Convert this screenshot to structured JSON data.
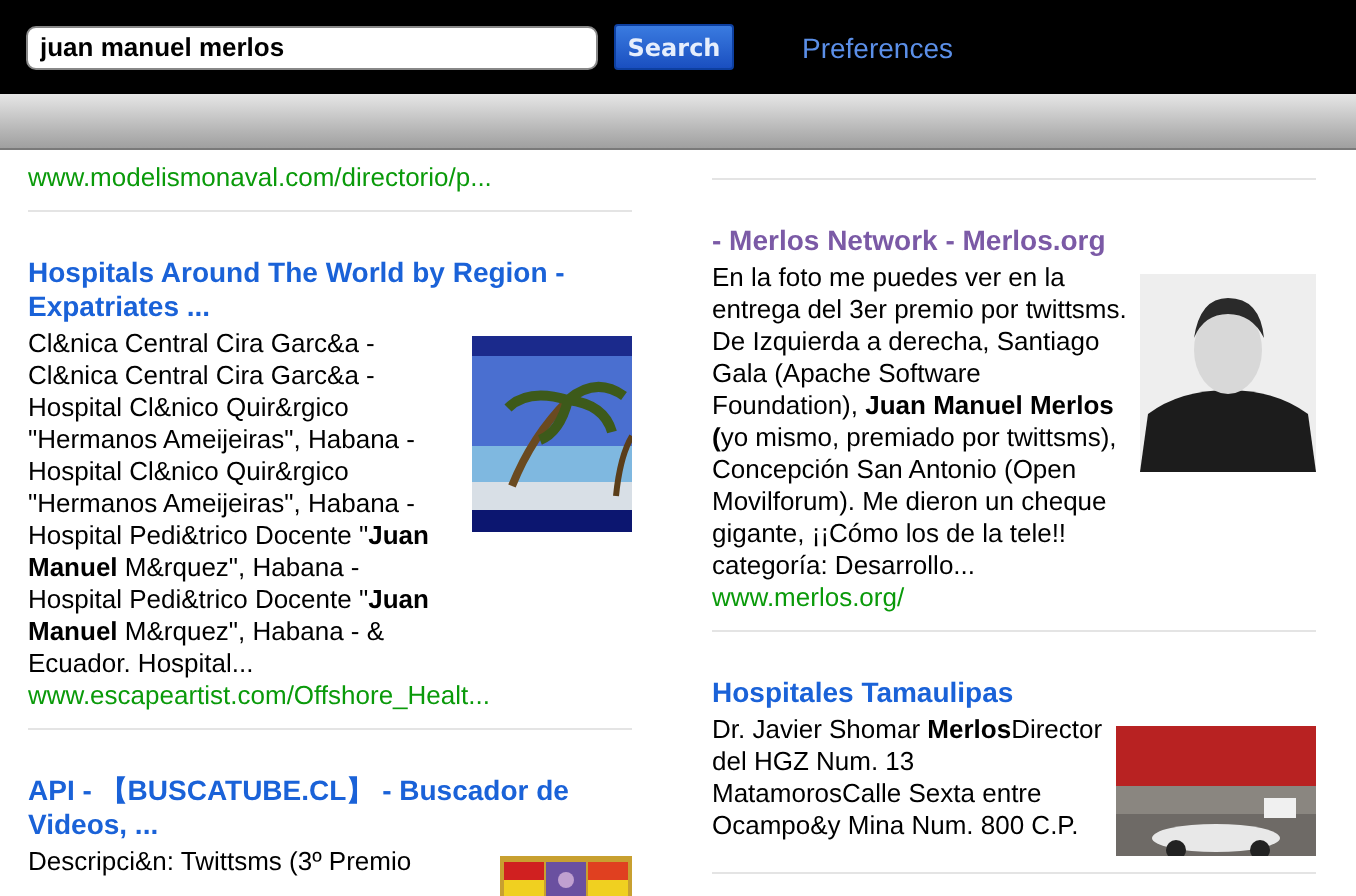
{
  "search": {
    "value": "juan manuel merlos",
    "button": "Search",
    "preferences": "Preferences"
  },
  "columns": [
    {
      "results": [
        {
          "url": "www.modelismonaval.com/directorio/p..."
        },
        {
          "title": "Hospitals Around The World by Region - Expatriates ...",
          "visited": false,
          "snippet": "Cl&nica Central Cira Garc&a - Cl&nica Central Cira Garc&a - Hospital Cl&nico Quir&rgico \"Hermanos Ameijeiras\", Habana - Hospital Cl&nico Quir&rgico \"Hermanos Ameijeiras\", Habana - Hospital Pedi&trico Docente \"**Juan Manuel** M&rquez\", Habana - Hospital Pedi&trico Docente \"**Juan Manuel** M&rquez\", Habana - & Ecuador. Hospital...",
          "url": "www.escapeartist.com/Offshore_Healt..."
        },
        {
          "title": "API - 【BUSCATUBE.CL】 - Buscador de Videos, ...",
          "visited": false,
          "snippet": "Descripci&n: Twittsms (3º Premio"
        }
      ]
    },
    {
      "results": [
        {
          "title": "- Merlos Network - Merlos.org",
          "visited": true,
          "snippet": "En la foto me puedes ver en la entrega del 3er premio por twittsms. De Izquierda a derecha, Santiago Gala (Apache Software Foundation), **Juan Manuel Merlos (**yo mismo, premiado por twittsms), Concepción San Antonio (Open Movilforum). Me dieron un cheque gigante, ¡¡Cómo los de la tele!! categoría: Desarrollo...",
          "url": "www.merlos.org/"
        },
        {
          "title": "Hospitales Tamaulipas",
          "visited": false,
          "snippet": "Dr. Javier Shomar **Merlos**Director del HGZ Num. 13 MatamorosCalle Sexta entre Ocampo&y Mina Num. 800 C.P."
        }
      ]
    }
  ]
}
